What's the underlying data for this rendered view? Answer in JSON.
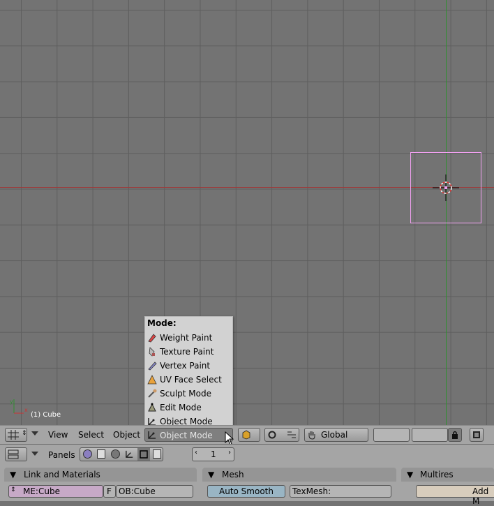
{
  "viewport": {
    "object_label": "(1) Cube",
    "axis_x_label": "x",
    "axis_y_label": "y"
  },
  "mode_menu": {
    "title": "Mode:",
    "items": [
      {
        "label": "Weight Paint",
        "icon": "weight-paint-icon"
      },
      {
        "label": "Texture Paint",
        "icon": "texture-paint-icon"
      },
      {
        "label": "Vertex Paint",
        "icon": "vertex-paint-icon"
      },
      {
        "label": "UV Face Select",
        "icon": "uv-face-select-icon"
      },
      {
        "label": "Sculpt Mode",
        "icon": "sculpt-mode-icon"
      },
      {
        "label": "Edit Mode",
        "icon": "edit-mode-icon"
      },
      {
        "label": "Object Mode",
        "icon": "object-mode-icon"
      }
    ]
  },
  "header": {
    "menus": [
      "View",
      "Select",
      "Object"
    ],
    "mode_current": "Object Mode",
    "orientation": "Global"
  },
  "buttons_window": {
    "panels_label": "Panels",
    "frame": "1"
  },
  "panels": {
    "link_materials": {
      "title": "Link and Materials",
      "mesh_name": "ME:Cube",
      "f_label": "F",
      "object_name": "OB:Cube"
    },
    "mesh": {
      "title": "Mesh",
      "auto_smooth": "Auto Smooth",
      "texmesh": "TexMesh:"
    },
    "multires": {
      "title": "Multires",
      "add": "Add M"
    }
  },
  "colors": {
    "viewport_bg": "#737373",
    "header_bg": "#a5a5a5",
    "selection_outline": "#f0a0f0"
  }
}
